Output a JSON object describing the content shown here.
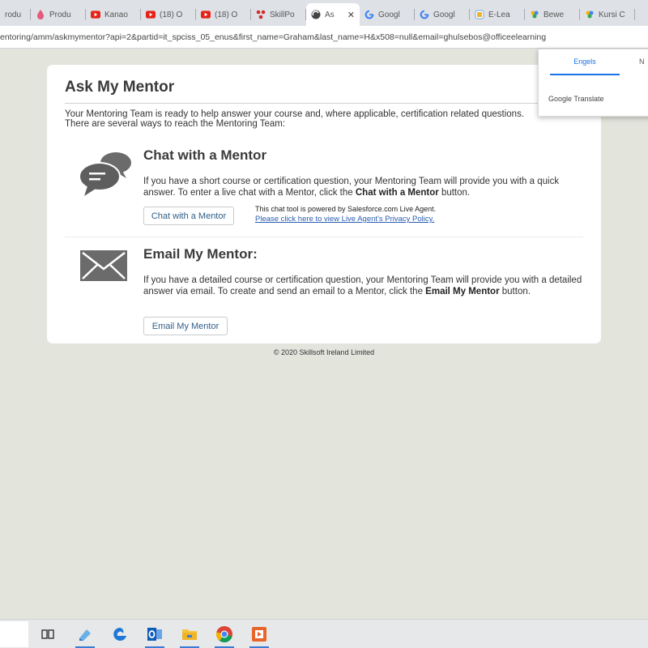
{
  "browser": {
    "tabs": [
      {
        "label": "rodu",
        "icon": "page-icon"
      },
      {
        "label": "Produ",
        "icon": "pink-drop-icon"
      },
      {
        "label": "Kanao",
        "icon": "youtube-icon"
      },
      {
        "label": "(18) O",
        "icon": "youtube-icon"
      },
      {
        "label": "(18) O",
        "icon": "youtube-icon"
      },
      {
        "label": "SkillPo",
        "icon": "skillport-icon"
      },
      {
        "label": "As",
        "icon": "skillsoft-icon",
        "active": true
      },
      {
        "label": "Googl",
        "icon": "google-icon"
      },
      {
        "label": "Googl",
        "icon": "google-icon"
      },
      {
        "label": "E-Lea",
        "icon": "elearning-icon"
      },
      {
        "label": "Bewe",
        "icon": "colorful-icon"
      },
      {
        "label": "Kursi C",
        "icon": "colorful-icon"
      }
    ],
    "close_glyph": "✕",
    "url": "entoring/amm/askmymentor?api=2&partid=it_spciss_05_enus&first_name=Graham&last_name=H&x508=null&email=ghulsebos@officeelearning"
  },
  "page": {
    "title": "Ask My Mentor",
    "intro": "Your Mentoring Team is ready to help answer your course and, where applicable, certification related questions. There are several ways to reach the Mentoring Team:",
    "chat": {
      "title": "Chat with a Mentor",
      "text_before": "If you have a short course or certification question, your Mentoring Team will provide you with a quick answer. To enter a live chat with a Mentor, click the ",
      "text_bold": "Chat with a Mentor",
      "text_after": " button.",
      "button": "Chat with a Mentor",
      "powered_by": "This chat tool is powered by Salesforce.com Live Agent.",
      "privacy_link": "Please click here to view Live Agent's Privacy Policy."
    },
    "email": {
      "title": "Email My Mentor:",
      "text_before": "If you have a detailed course or certification question, your Mentoring Team will provide you with a detailed answer via email. To create and send an email to a Mentor, click the ",
      "text_bold": "Email My Mentor",
      "text_after": " button.",
      "button": "Email My Mentor"
    },
    "copyright": "© 2020 Skillsoft Ireland Limited"
  },
  "translate_popup": {
    "tab_active": "Engels",
    "tab_other": "N",
    "footer": "Google Translate"
  },
  "taskbar": {
    "apps": [
      "task-view-icon",
      "file-icon",
      "edge-icon",
      "outlook-icon",
      "file-explorer-icon",
      "chrome-icon",
      "presentation-icon"
    ]
  },
  "colors": {
    "page_background": "#e3e5dd",
    "link": "#2a5db0",
    "button_text": "#2f5e87",
    "icon_gray": "#6b6b6b"
  }
}
